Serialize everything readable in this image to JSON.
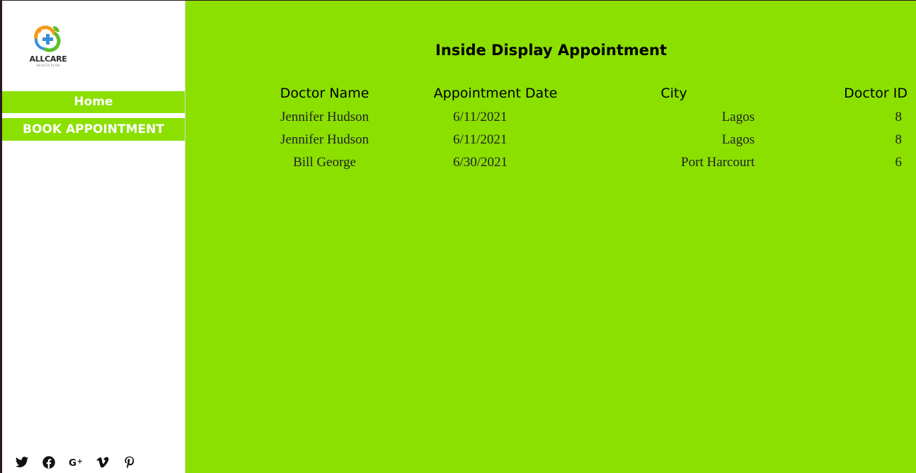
{
  "brand": {
    "name": "ALLCARE",
    "tagline": "HEALTH PLAN",
    "logo_colors": [
      "#f29a1a",
      "#3a8fd6",
      "#5cbf2a"
    ]
  },
  "sidebar": {
    "nav": [
      {
        "label": "Home"
      },
      {
        "label": "BOOK APPOINTMENT"
      }
    ],
    "social_icons": [
      "twitter-icon",
      "facebook-icon",
      "google-plus-icon",
      "vimeo-icon",
      "pinterest-icon"
    ]
  },
  "main": {
    "title": "Inside Display Appointment",
    "table": {
      "columns": [
        "Doctor Name",
        "Appointment Date",
        "City",
        "Doctor ID"
      ],
      "rows": [
        [
          "Jennifer Hudson",
          "6/11/2021",
          "Lagos",
          "8"
        ],
        [
          "Jennifer Hudson",
          "6/11/2021",
          "Lagos",
          "8"
        ],
        [
          "Bill George",
          "6/30/2021",
          "Port Harcourt",
          "6"
        ]
      ]
    }
  },
  "colors": {
    "accent": "#8be000",
    "sidebar_bg": "#ffffff",
    "text": "#000000"
  }
}
